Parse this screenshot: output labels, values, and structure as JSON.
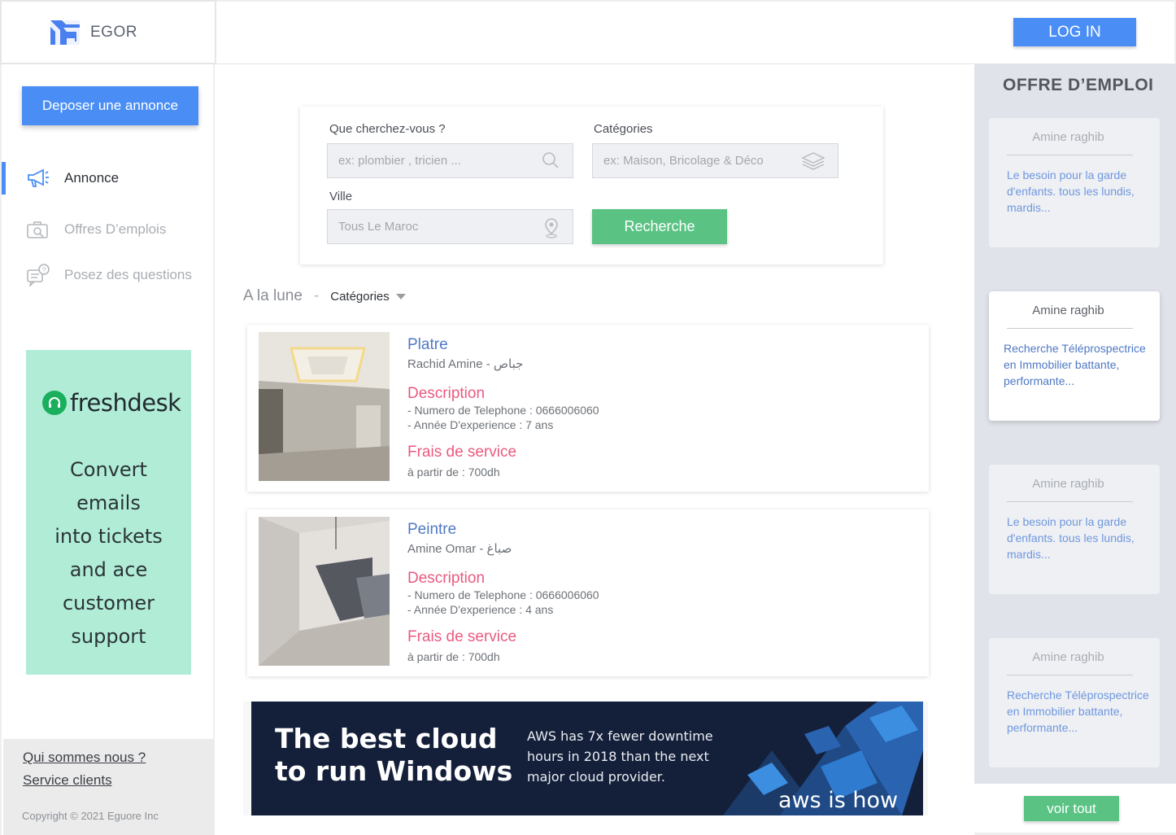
{
  "header": {
    "logo_text": "EGOR",
    "login_label": "LOG IN"
  },
  "sidebar": {
    "post_button": "Deposer une annonce",
    "items": [
      {
        "label": "Annonce",
        "icon": "megaphone-icon",
        "active": true
      },
      {
        "label": "Offres D’emplois",
        "icon": "briefcase-icon",
        "active": false
      },
      {
        "label": "Posez des questions",
        "icon": "question-chat-icon",
        "active": false
      }
    ],
    "ad": {
      "brand": "freshdesk",
      "copy": "Convert\nemails\ninto tickets\nand ace\ncustomer\nsupport"
    },
    "footer": {
      "about": "Qui sommes nous ?",
      "service": "Service clients",
      "copyright": "Copyright © 2021 Eguore Inc"
    }
  },
  "search": {
    "query_label": "Que cherchez-vous ?",
    "query_placeholder": "ex: plombier , tricien ...",
    "category_label": "Catégories",
    "category_placeholder": "ex: Maison, Bricolage & Déco",
    "city_label": "Ville",
    "city_value": "Tous Le Maroc",
    "submit_label": "Recherche"
  },
  "filter": {
    "location": "A la lune",
    "separator": "-",
    "category": "Catégories"
  },
  "listings": [
    {
      "title": "Platre",
      "owner": "Rachid Amine - جباص",
      "desc_heading": "Description",
      "phone": "- Numero de Telephone : 0666006060",
      "experience": "- Année D'experience : 7 ans",
      "fee_heading": "Frais de service",
      "price": "à partir de : 700dh"
    },
    {
      "title": "Peintre",
      "owner": "Amine Omar - صباغ",
      "desc_heading": "Description",
      "phone": "- Numero de Telephone : 0666006060",
      "experience": "- Année D'experience : 4 ans",
      "fee_heading": "Frais de service",
      "price": "à partir de : 700dh"
    }
  ],
  "aws_banner": {
    "headline": "The best cloud\nto run Windows",
    "body": "AWS has 7x fewer downtime\nhours in 2018 than the next\nmajor cloud provider.",
    "tagline": "aws is how"
  },
  "jobs": {
    "title": "OFFRE D’EMPLOI",
    "items": [
      {
        "name": "Amine raghib",
        "desc": "Le besoin pour la garde d'enfants. tous les lundis, mardis..."
      },
      {
        "name": "Amine raghib",
        "desc": "Recherche Téléprospectrice en Immobilier battante, performante..."
      },
      {
        "name": "Amine raghib",
        "desc": "Le besoin pour la garde d'enfants. tous les lundis, mardis..."
      },
      {
        "name": "Amine raghib",
        "desc": "Recherche Téléprospectrice en Immobilier battante, performante..."
      }
    ],
    "see_all": "voir tout"
  },
  "colors": {
    "primary": "#4a8ef5",
    "success": "#5ac384",
    "accent_red": "#ea5a80",
    "title_blue": "#4f78c4"
  }
}
